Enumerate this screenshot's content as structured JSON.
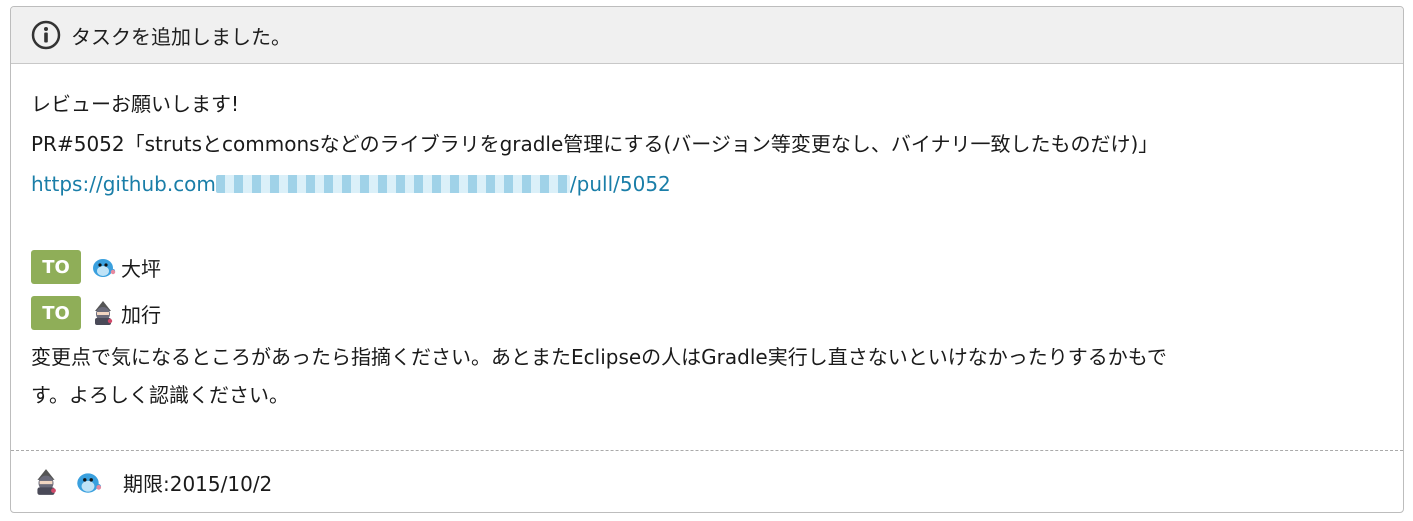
{
  "header": {
    "icon": "info-icon",
    "title": "タスクを追加しました。"
  },
  "body": {
    "line1": "レビューお願いします!",
    "line2": "PR#5052「strutsとcommonsなどのライブラリをgradle管理にする(バージョン等変更なし、バイナリ一致したものだけ)」",
    "link_prefix": "https://github.com",
    "link_suffix": "/pull/5052",
    "to_items": [
      {
        "badge": "TO",
        "name": "大坪",
        "avatar": "blue-bird-avatar"
      },
      {
        "badge": "TO",
        "name": "加行",
        "avatar": "ninja-avatar"
      }
    ],
    "message_line1": "変更点で気になるところがあったら指摘ください。あとまたEclipseの人はGradle実行し直さないといけなかったりするかもで",
    "message_line2": "す。よろしく認識ください。"
  },
  "footer": {
    "deadline": "期限:2015/10/2"
  },
  "colors": {
    "link": "#1a7ea8",
    "to_badge": "#8fae58",
    "header_bg": "#f0f0f0"
  }
}
